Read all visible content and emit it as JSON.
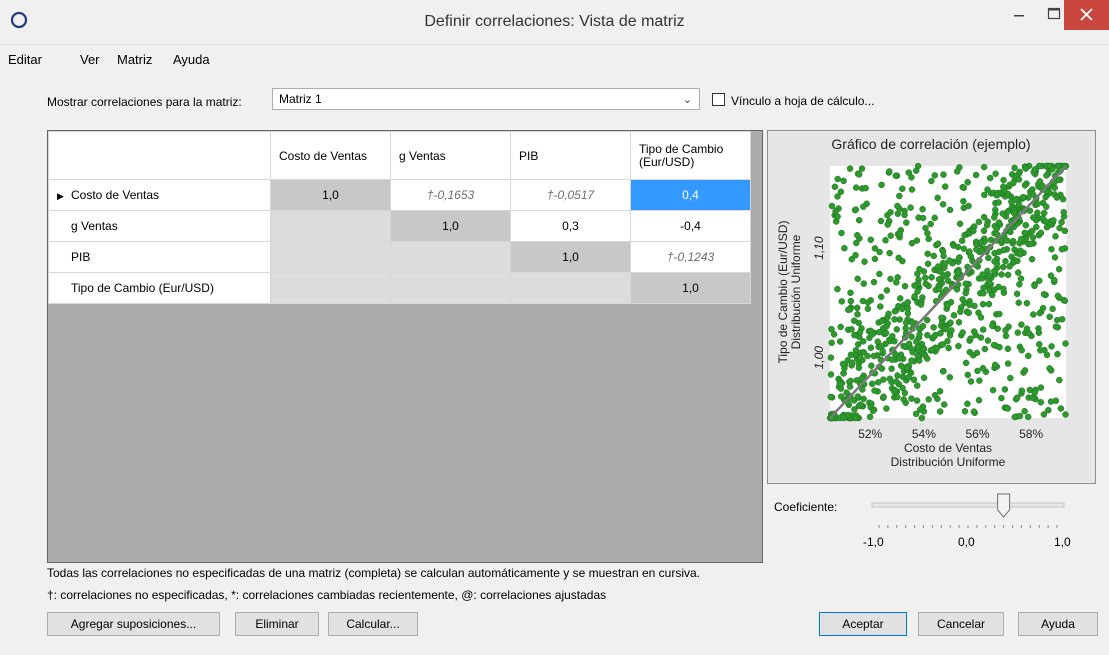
{
  "window": {
    "title": "Definir correlaciones: Vista de matriz",
    "controls": {
      "minimize": "minimize-icon",
      "maximize": "maximize-icon",
      "close": "close-icon"
    },
    "close_color": "#c9463d"
  },
  "menu": {
    "items": [
      "Editar",
      "Ver",
      "Matriz",
      "Ayuda"
    ]
  },
  "matrix_selector": {
    "label": "Mostrar correlaciones para la matriz:",
    "selected": "Matriz 1",
    "link_checkbox_label": "Vínculo a hoja de cálculo...",
    "link_checked": false
  },
  "grid": {
    "columns": [
      "Costo de Ventas",
      "g Ventas",
      "PIB",
      "Tipo de Cambio (Eur/USD)"
    ],
    "column_header_lines": [
      [
        "Costo de Ventas"
      ],
      [
        "g Ventas"
      ],
      [
        "PIB"
      ],
      [
        "Tipo de Cambio",
        "(Eur/USD)"
      ]
    ],
    "rows": [
      {
        "label": "Costo de Ventas",
        "current": true,
        "cells": [
          "1,0",
          "†-0,1653",
          "†-0,0517",
          "0,4"
        ]
      },
      {
        "label": "g Ventas",
        "current": false,
        "cells": [
          "",
          "1,0",
          "0,3",
          "-0,4"
        ]
      },
      {
        "label": "PIB",
        "current": false,
        "cells": [
          "",
          "",
          "1,0",
          "†-0,1243"
        ]
      },
      {
        "label": "Tipo de Cambio (Eur/USD)",
        "current": false,
        "cells": [
          "",
          "",
          "",
          "1,0"
        ]
      }
    ],
    "selected_cell": {
      "row": 0,
      "col": 3
    },
    "selection_color": "#3399ff"
  },
  "chart": {
    "title": "Gráfico de correlación (ejemplo)",
    "xlabel_lines": [
      "Costo de Ventas",
      "Distribución Uniforme"
    ],
    "ylabel_lines": [
      "Tipo de Cambio (Eur/USD)",
      "Distribución Uniforme"
    ],
    "x_ticks": [
      "52%",
      "54%",
      "56%",
      "58%"
    ],
    "y_ticks": [
      "1,00",
      "1,10"
    ],
    "point_color": "#2e9a2e"
  },
  "chart_data": {
    "type": "scatter",
    "title": "Gráfico de correlación (ejemplo)",
    "xlabel": "Costo de Ventas Distribución Uniforme",
    "ylabel": "Tipo de Cambio (Eur/USD) Distribución Uniforme",
    "xlim": [
      0.505,
      0.593
    ],
    "ylim": [
      0.945,
      1.175
    ],
    "x_ticks": [
      0.52,
      0.54,
      0.56,
      0.58
    ],
    "y_ticks": [
      1.0,
      1.1
    ],
    "trend_line": {
      "from": [
        0.505,
        0.945
      ],
      "to": [
        0.593,
        1.175
      ]
    },
    "correlation": 0.4,
    "point_count": 900
  },
  "coefficient_slider": {
    "label": "Coeficiente:",
    "min_label": "-1,0",
    "mid_label": "0,0",
    "max_label": "1,0",
    "min": -1.0,
    "max": 1.0,
    "value": 0.4
  },
  "notes": {
    "line1": "Todas las correlaciones no especificadas de una matriz (completa) se calculan automáticamente y se muestran en cursiva.",
    "line2": "†: correlaciones no especificadas, *: correlaciones cambiadas recientemente, @: correlaciones ajustadas"
  },
  "buttons": {
    "add_assumptions": "Agregar suposiciones...",
    "delete": "Eliminar",
    "calculate": "Calcular...",
    "accept": "Aceptar",
    "cancel": "Cancelar",
    "help": "Ayuda"
  }
}
